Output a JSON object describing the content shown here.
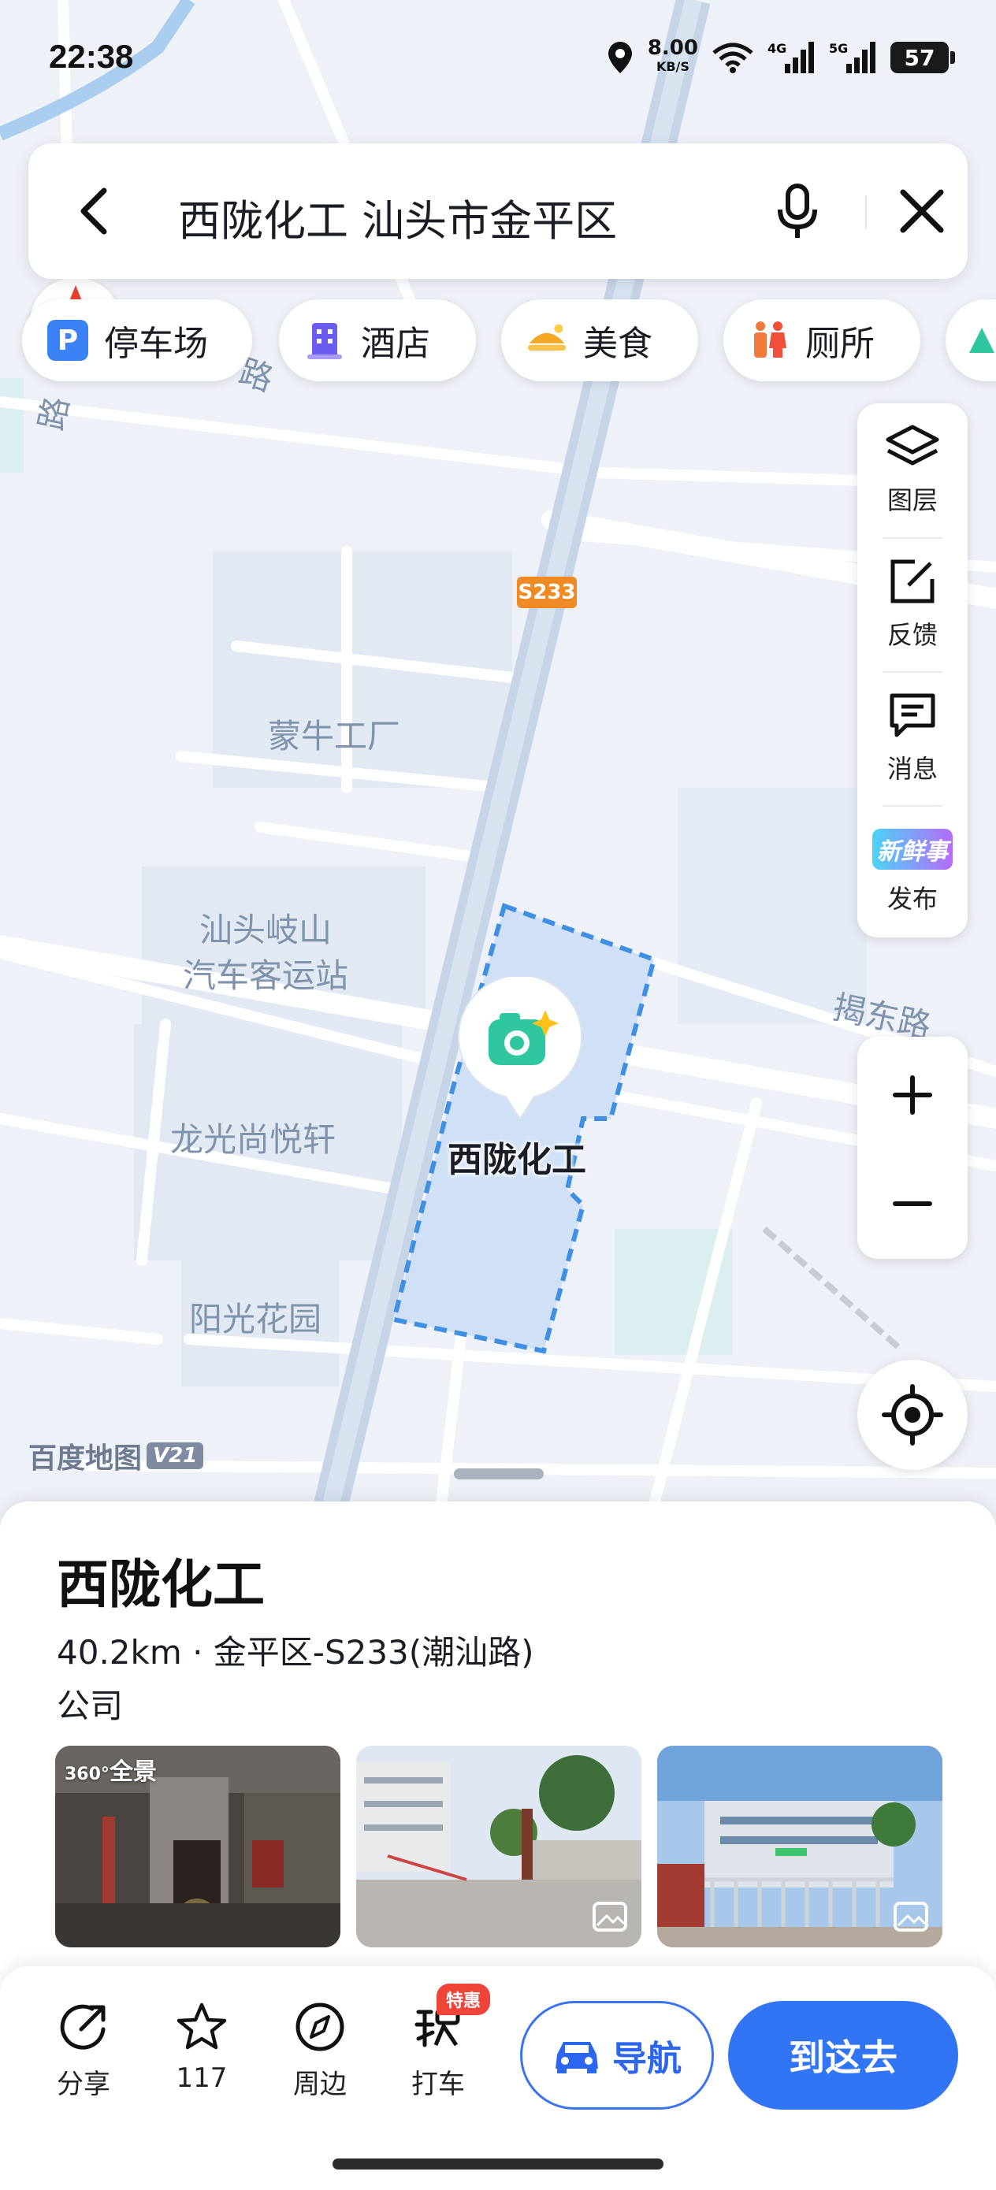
{
  "status_bar": {
    "time": "22:38",
    "speed_value": "8.00",
    "speed_unit": "KB/S",
    "battery": "57"
  },
  "search": {
    "query": "西陇化工 汕头市金平区"
  },
  "chips": [
    {
      "label": "停车场",
      "icon": "parking-icon",
      "glyph": "P",
      "color": "#3b82f6"
    },
    {
      "label": "酒店",
      "icon": "hotel-icon",
      "color": "#6b5cf0"
    },
    {
      "label": "美食",
      "icon": "food-icon",
      "color": "#f5a623"
    },
    {
      "label": "厕所",
      "icon": "toilet-icon",
      "color": "#f07a3a"
    }
  ],
  "tools": [
    {
      "label": "图层",
      "icon": "layers-icon"
    },
    {
      "label": "反馈",
      "icon": "feedback-icon"
    },
    {
      "label": "消息",
      "icon": "message-icon"
    },
    {
      "label": "发布",
      "icon": "news-icon",
      "badge_text": "新鲜事"
    }
  ],
  "map": {
    "road_shield": "S233",
    "labels": {
      "mengniu": "蒙牛工厂",
      "qishan": "汕头岐山\n汽车客运站",
      "longguang": "龙光尚悦轩",
      "yangguang": "阳光花园",
      "jiedong": "揭东路",
      "road_top1": "路",
      "road_top2": "路"
    },
    "poi_name": "西陇化工",
    "watermark": "百度地图",
    "watermark_ver": "V21"
  },
  "place": {
    "title": "西陇化工",
    "meta": "40.2km · 金平区-S233(潮汕路)",
    "category": "公司",
    "photos": [
      {
        "tag": "全景",
        "tag_prefix": "360°"
      },
      {
        "tag": ""
      },
      {
        "tag": ""
      }
    ]
  },
  "actions": [
    {
      "label": "分享",
      "icon": "share-icon"
    },
    {
      "label": "117",
      "icon": "star-icon"
    },
    {
      "label": "周边",
      "icon": "compass-icon"
    },
    {
      "label": "打车",
      "icon": "taxi-icon",
      "badge": "特惠"
    }
  ],
  "buttons": {
    "navigate": "导航",
    "go_here": "到这去"
  },
  "colors": {
    "accent": "#3175f5",
    "map_bg": "#eef1f7",
    "poi_area": "#cfe0f7"
  }
}
